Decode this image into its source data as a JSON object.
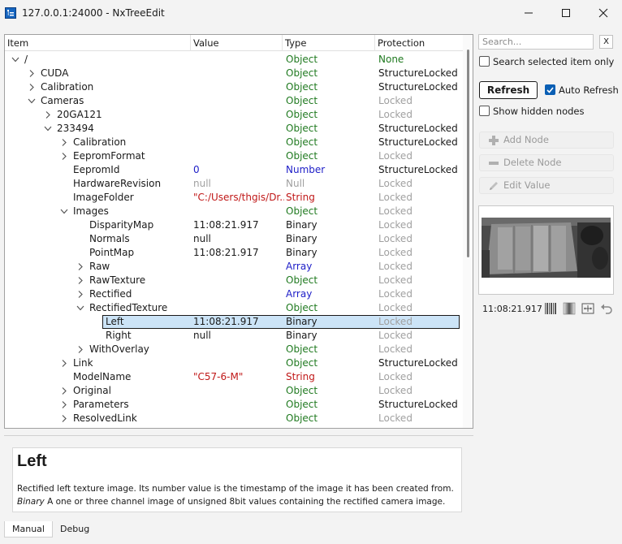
{
  "window": {
    "title": "127.0.0.1:24000 - NxTreeEdit"
  },
  "tree": {
    "columns": [
      "Item",
      "Value",
      "Type",
      "Protection"
    ],
    "rows": [
      {
        "depth": 0,
        "exp": "open",
        "name": "/",
        "value": "",
        "vstyle": "",
        "type": "Object",
        "prot": "None"
      },
      {
        "depth": 1,
        "exp": "closed",
        "name": "CUDA",
        "value": "",
        "vstyle": "",
        "type": "Object",
        "prot": "StructureLocked"
      },
      {
        "depth": 1,
        "exp": "closed",
        "name": "Calibration",
        "value": "",
        "vstyle": "",
        "type": "Object",
        "prot": "StructureLocked"
      },
      {
        "depth": 1,
        "exp": "open",
        "name": "Cameras",
        "value": "",
        "vstyle": "",
        "type": "Object",
        "prot": "Locked"
      },
      {
        "depth": 2,
        "exp": "closed",
        "name": "20GA121",
        "value": "",
        "vstyle": "",
        "type": "Object",
        "prot": "Locked"
      },
      {
        "depth": 2,
        "exp": "open",
        "name": "233494",
        "value": "",
        "vstyle": "",
        "type": "Object",
        "prot": "StructureLocked"
      },
      {
        "depth": 3,
        "exp": "closed",
        "name": "Calibration",
        "value": "",
        "vstyle": "",
        "type": "Object",
        "prot": "StructureLocked"
      },
      {
        "depth": 3,
        "exp": "closed",
        "name": "EepromFormat",
        "value": "",
        "vstyle": "",
        "type": "Object",
        "prot": "Locked"
      },
      {
        "depth": 3,
        "exp": "none",
        "name": "EepromId",
        "value": "0",
        "vstyle": "blue",
        "type": "Number",
        "prot": "StructureLocked"
      },
      {
        "depth": 3,
        "exp": "none",
        "name": "HardwareRevision",
        "value": "null",
        "vstyle": "gray",
        "type": "Null",
        "prot": "Locked"
      },
      {
        "depth": 3,
        "exp": "none",
        "name": "ImageFolder",
        "value": "\"C:/Users/thgis/Dr...",
        "vstyle": "red",
        "type": "String",
        "prot": "Locked"
      },
      {
        "depth": 3,
        "exp": "open",
        "name": "Images",
        "value": "",
        "vstyle": "",
        "type": "Object",
        "prot": "Locked"
      },
      {
        "depth": 4,
        "exp": "none",
        "name": "DisparityMap",
        "value": "11:08:21.917",
        "vstyle": "",
        "type": "Binary",
        "prot": "Locked"
      },
      {
        "depth": 4,
        "exp": "none",
        "name": "Normals",
        "value": "null",
        "vstyle": "",
        "type": "Binary",
        "prot": "Locked"
      },
      {
        "depth": 4,
        "exp": "none",
        "name": "PointMap",
        "value": "11:08:21.917",
        "vstyle": "",
        "type": "Binary",
        "prot": "Locked"
      },
      {
        "depth": 4,
        "exp": "closed",
        "name": "Raw",
        "value": "",
        "vstyle": "",
        "type": "Array",
        "prot": "Locked"
      },
      {
        "depth": 4,
        "exp": "closed",
        "name": "RawTexture",
        "value": "",
        "vstyle": "",
        "type": "Object",
        "prot": "Locked"
      },
      {
        "depth": 4,
        "exp": "closed",
        "name": "Rectified",
        "value": "",
        "vstyle": "",
        "type": "Array",
        "prot": "Locked"
      },
      {
        "depth": 4,
        "exp": "open",
        "name": "RectifiedTexture",
        "value": "",
        "vstyle": "",
        "type": "Object",
        "prot": "Locked"
      },
      {
        "depth": 5,
        "exp": "none",
        "name": "Left",
        "value": "11:08:21.917",
        "vstyle": "",
        "type": "Binary",
        "prot": "Locked",
        "selected": true
      },
      {
        "depth": 5,
        "exp": "none",
        "name": "Right",
        "value": "null",
        "vstyle": "",
        "type": "Binary",
        "prot": "Locked"
      },
      {
        "depth": 4,
        "exp": "closed",
        "name": "WithOverlay",
        "value": "",
        "vstyle": "",
        "type": "Object",
        "prot": "Locked"
      },
      {
        "depth": 3,
        "exp": "closed",
        "name": "Link",
        "value": "",
        "vstyle": "",
        "type": "Object",
        "prot": "StructureLocked"
      },
      {
        "depth": 3,
        "exp": "none",
        "name": "ModelName",
        "value": "\"C57-6-M\"",
        "vstyle": "red",
        "type": "String",
        "prot": "Locked"
      },
      {
        "depth": 3,
        "exp": "closed",
        "name": "Original",
        "value": "",
        "vstyle": "",
        "type": "Object",
        "prot": "Locked"
      },
      {
        "depth": 3,
        "exp": "closed",
        "name": "Parameters",
        "value": "",
        "vstyle": "",
        "type": "Object",
        "prot": "StructureLocked"
      },
      {
        "depth": 3,
        "exp": "closed",
        "name": "ResolvedLink",
        "value": "",
        "vstyle": "",
        "type": "Object",
        "prot": "Locked"
      }
    ]
  },
  "sidebar": {
    "search_placeholder": "Search...",
    "clear_label": "X",
    "search_selected_only": {
      "label": "Search selected item only",
      "checked": false
    },
    "refresh_label": "Refresh",
    "auto_refresh": {
      "label": "Auto Refresh",
      "checked": true
    },
    "show_hidden": {
      "label": "Show hidden nodes",
      "checked": false
    },
    "add_node_label": "Add Node",
    "delete_node_label": "Delete Node",
    "edit_value_label": "Edit Value",
    "image_timestamp": "11:08:21.917"
  },
  "description": {
    "title": "Left",
    "line1": "Rectified left texture image. Its number value is the timestamp of the image it has been created from.",
    "line2_type": "Binary",
    "line2_text": " A one or three channel image of unsigned 8bit values containing the rectified camera image."
  },
  "tabs": [
    {
      "label": "Manual",
      "active": true
    },
    {
      "label": "Debug",
      "active": false
    }
  ],
  "colors": {
    "accent": "#0a5fb4",
    "selection": "#cce4f7",
    "type_object": "#207a20",
    "type_number": "#2020c8",
    "type_string": "#c01818",
    "locked": "#a0a0a0"
  }
}
